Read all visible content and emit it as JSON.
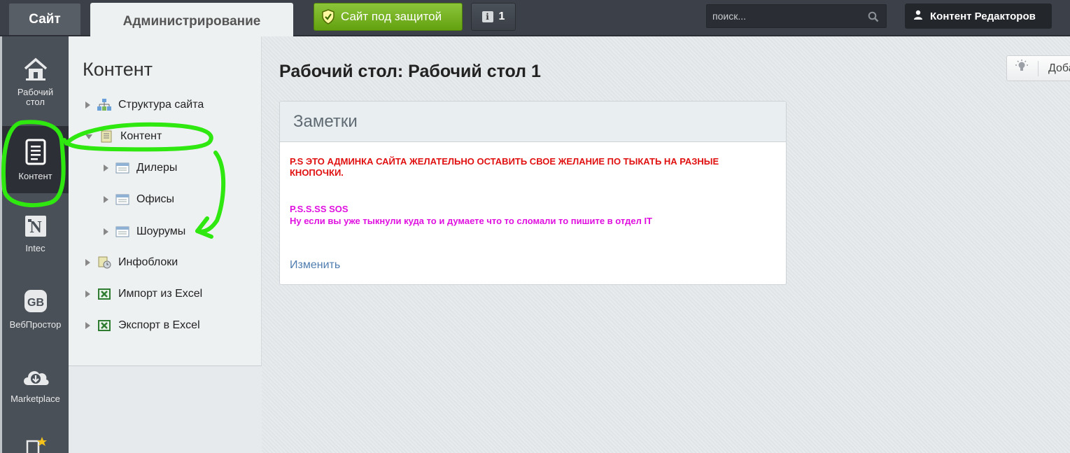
{
  "topbar": {
    "site_tab": "Сайт",
    "admin_tab": "Администрирование",
    "protect_button": "Сайт под защитой",
    "notifications_count": "1",
    "search_placeholder": "поиск...",
    "user_name": "Контент Редакторов"
  },
  "iconbar": {
    "items": [
      {
        "label_line1": "Рабочий",
        "label_line2": "стол",
        "icon": "home-icon"
      },
      {
        "label_line1": "Контент",
        "label_line2": "",
        "icon": "document-icon"
      },
      {
        "label_line1": "Intec",
        "label_line2": "",
        "icon": "intec-icon"
      },
      {
        "label_line1": "ВебПростор",
        "label_line2": "",
        "icon": "webprostor-icon"
      },
      {
        "label_line1": "Marketplace",
        "label_line2": "",
        "icon": "cloud-download-icon"
      }
    ]
  },
  "submenu": {
    "title": "Контент",
    "items": [
      {
        "label": "Структура сайта",
        "icon": "site-structure-icon"
      },
      {
        "label": "Контент",
        "icon": "content-icon"
      },
      {
        "label": "Дилеры",
        "icon": "table-icon"
      },
      {
        "label": "Офисы",
        "icon": "table-icon"
      },
      {
        "label": "Шоурумы",
        "icon": "table-icon"
      },
      {
        "label": "Инфоблоки",
        "icon": "infoblocks-icon"
      },
      {
        "label": "Импорт из Excel",
        "icon": "excel-icon"
      },
      {
        "label": "Экспорт в Excel",
        "icon": "excel-icon"
      }
    ]
  },
  "main": {
    "page_title": "Рабочий стол: Рабочий стол 1",
    "add_button": "Доба",
    "notes": {
      "title": "Заметки",
      "red_text": "P.S ЭТО АДМИНКА САЙТА ЖЕЛАТЕЛЬНО ОСТАВИТЬ СВОЕ ЖЕЛАНИЕ ПО ТЫКАТЬ НА РАЗНЫЕ КНОПОЧКИ.",
      "magenta_line1": "P.S.S.SS SOS",
      "magenta_line2": "Ну если вы уже тыкнули куда то и думаете что то сломали то пишите в отдел IT",
      "edit_link": "Изменить"
    }
  },
  "colors": {
    "accent_green": "#6fb51d",
    "note_red": "#e01010",
    "note_magenta": "#e010e0",
    "link_blue": "#4f7db0",
    "annotation_green": "#2ee80f"
  }
}
